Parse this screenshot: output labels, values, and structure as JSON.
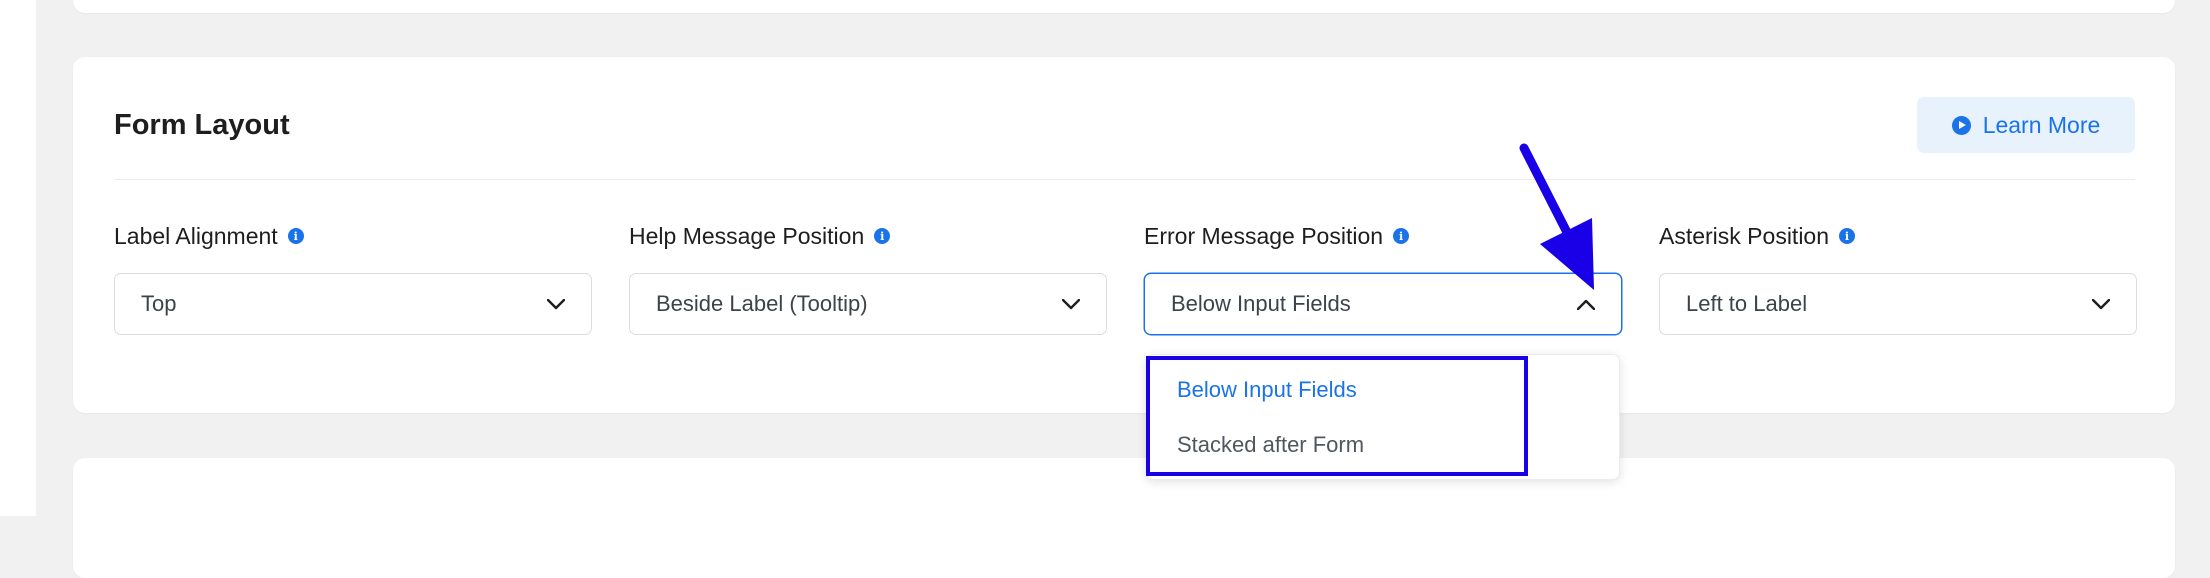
{
  "form_layout": {
    "title": "Form Layout",
    "learn_more_label": "Learn More",
    "fields": [
      {
        "label": "Label Alignment",
        "value": "Top"
      },
      {
        "label": "Help Message Position",
        "value": "Beside Label (Tooltip)"
      },
      {
        "label": "Error Message Position",
        "value": "Below Input Fields",
        "open": true
      },
      {
        "label": "Asterisk Position",
        "value": "Left to Label"
      }
    ],
    "dropdown_options": [
      "Below Input Fields",
      "Stacked after Form"
    ]
  },
  "colors": {
    "accent": "#1a73e8",
    "annotation": "#1a00e6",
    "background": "#f1f1f1"
  },
  "icons": [
    "play-icon",
    "info-icon",
    "chevron-down-icon",
    "chevron-up-icon",
    "annotation-arrow"
  ]
}
